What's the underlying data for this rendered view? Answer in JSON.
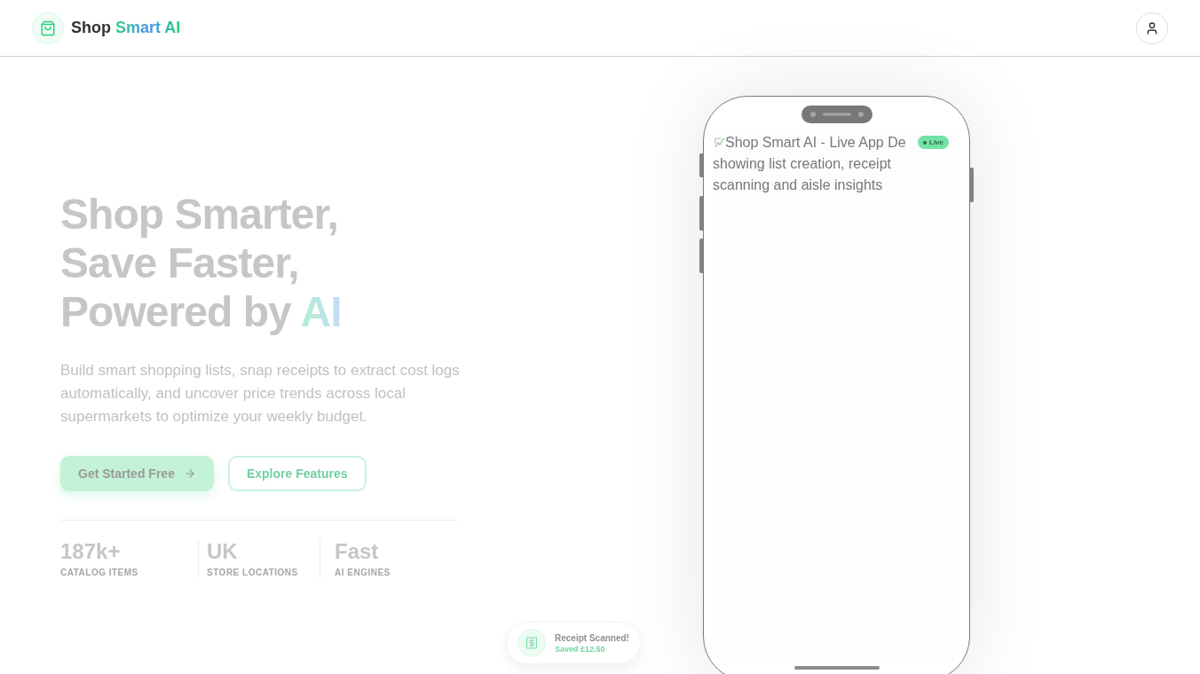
{
  "header": {
    "brand": {
      "name": "Shop",
      "highlight": "Smart AI"
    }
  },
  "hero": {
    "heading": {
      "lines": [
        "Shop Smarter,",
        "Save Faster,",
        "Powered by"
      ],
      "highlight": "AI"
    },
    "description": "Build smart shopping lists, snap receipts to extract cost logs automatically, and uncover price trends across local supermarkets to optimize your weekly budget.",
    "buttons": [
      {
        "kind": "primary",
        "label": "Get Started Free"
      },
      {
        "kind": "secondary",
        "label": "Explore Features"
      }
    ],
    "stats": [
      {
        "value": "187k+",
        "label": "CATALOG ITEMS"
      },
      {
        "value": "UK",
        "label": "STORE LOCATIONS"
      },
      {
        "value": "Fast",
        "label": "AI ENGINES"
      }
    ]
  },
  "phone": {
    "image_alt": {
      "first_line": "Shop Smart AI - Live App De",
      "rest": "showing list creation, receipt scanning and aisle insights"
    },
    "badge": "Live"
  },
  "toast": {
    "title": "Receipt Scanned!",
    "subtitle": "Saved £12.50"
  }
}
